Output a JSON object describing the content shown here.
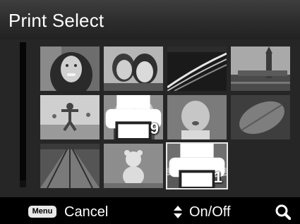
{
  "header": {
    "title": "Print Select"
  },
  "thumbnails": [
    {
      "subject": "smiling-woman-portrait",
      "print_marked": false,
      "count": ""
    },
    {
      "subject": "couple-portrait",
      "print_marked": false,
      "count": ""
    },
    {
      "subject": "night-highway-light-trails",
      "print_marked": false,
      "count": ""
    },
    {
      "subject": "big-ben-cityscape",
      "print_marked": false,
      "count": ""
    },
    {
      "subject": "people-jumping-beach",
      "print_marked": false,
      "count": ""
    },
    {
      "subject": "two-children",
      "print_marked": true,
      "count": "9"
    },
    {
      "subject": "crying-baby",
      "print_marked": false,
      "count": ""
    },
    {
      "subject": "leaf-closeup",
      "print_marked": false,
      "count": ""
    },
    {
      "subject": "tent-interior",
      "print_marked": false,
      "count": ""
    },
    {
      "subject": "teddy-bear",
      "print_marked": false,
      "count": ""
    },
    {
      "subject": "sea-landscape",
      "print_marked": true,
      "count": "1",
      "selected": true
    },
    {
      "subject": "empty",
      "print_marked": false,
      "count": ""
    }
  ],
  "footer": {
    "menu_key": "Menu",
    "cancel_label": "Cancel",
    "updown_icon": "up-down-arrows-icon",
    "onoff_label": "On/Off",
    "zoom_icon": "magnifier-icon"
  },
  "colors": {
    "background": "#000000",
    "panel": "#262626",
    "selection": "#e8e8e8"
  }
}
